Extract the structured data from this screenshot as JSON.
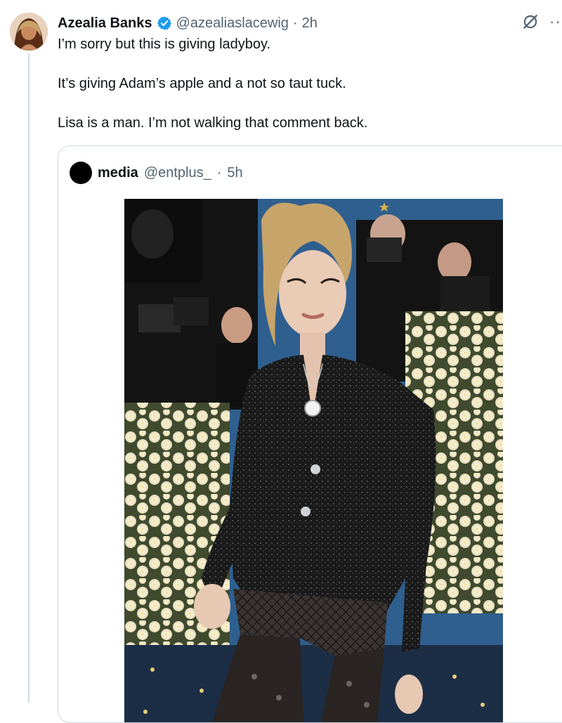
{
  "tweet": {
    "author": {
      "display_name": "Azealia Banks",
      "handle": "@azealiaslacewig",
      "verified": true
    },
    "separator": "·",
    "time": "2h",
    "paragraphs": [
      "I’m sorry but this is giving ladyboy.",
      "It’s giving Adam’s apple and a not so taut tuck.",
      "Lisa is a man. I’m not walking that comment back."
    ],
    "actions": {
      "grok_icon": "grok-icon",
      "more_icon": "more-icon",
      "more_label": "···"
    }
  },
  "quote": {
    "author": {
      "display_name": "media",
      "handle": "@entplus_"
    },
    "separator": "·",
    "time": "5h"
  },
  "colors": {
    "text": "#0f1419",
    "muted": "#536471",
    "border": "#cfd9de",
    "verified_blue": "#1d9bf0",
    "backdrop_blue": "#2f5f8f",
    "flower_cream": "#f3ecd0"
  }
}
